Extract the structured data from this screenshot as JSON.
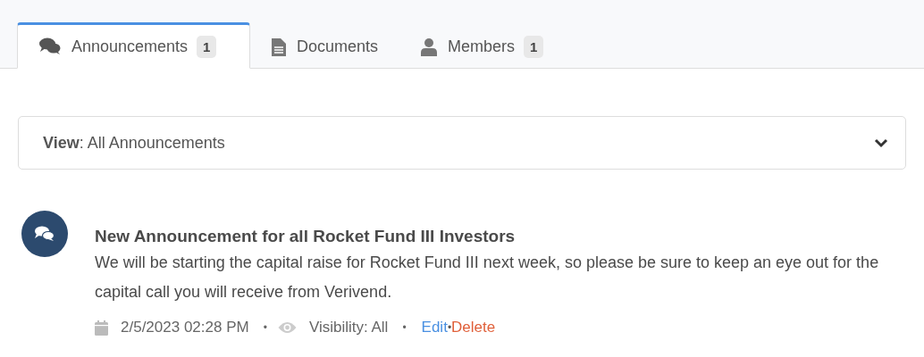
{
  "tabs": [
    {
      "label": "Announcements",
      "kind": "comments",
      "count": "1",
      "selected": true
    },
    {
      "label": "Documents",
      "kind": "file",
      "selected": false
    },
    {
      "label": "Members",
      "kind": "user",
      "count": "1",
      "selected": false
    }
  ],
  "view_select": {
    "value": "**View**: All Announcements"
  },
  "announcements": [
    {
      "title": "New Announcement for all Rocket Fund III Investors",
      "body": "We will be starting the capital raise for Rocket Fund III next week, so please be sure to keep an eye out for the capital call you will receive from Verivend.",
      "date": "2/5/2023 02:28 PM",
      "separator_1": "•",
      "visibility": "Visibility: All",
      "separator_2": "•",
      "actions": [
        {
          "label": "Edit",
          "kind": "edit"
        },
        {
          "label": "•",
          "kind": "separator"
        },
        {
          "label": "Delete",
          "kind": "delete"
        }
      ]
    }
  ]
}
